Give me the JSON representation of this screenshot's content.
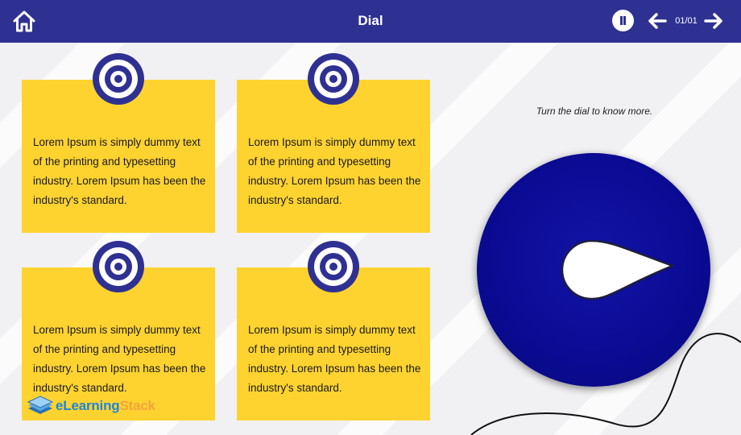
{
  "header": {
    "title": "Dial",
    "page_indicator": "01/01",
    "icons": {
      "home": "home-icon",
      "pause": "pause-icon",
      "prev": "arrow-left-icon",
      "next": "arrow-right-icon"
    }
  },
  "cards": [
    {
      "icon": "target-icon",
      "text": "Lorem Ipsum is simply dummy text of the printing and typesetting industry. Lorem Ipsum has been the industry's standard."
    },
    {
      "icon": "target-icon",
      "text": "Lorem Ipsum is simply dummy text of the printing and typesetting industry. Lorem Ipsum has been the industry's standard."
    },
    {
      "icon": "target-icon",
      "text": "Lorem Ipsum is simply dummy text of the printing and typesetting industry. Lorem Ipsum has been the industry's standard."
    },
    {
      "icon": "target-icon",
      "text": "Lorem Ipsum is simply dummy text of the printing and typesetting industry. Lorem Ipsum has been the industry's standard."
    }
  ],
  "dial": {
    "instruction": "Turn the dial to know more."
  },
  "logo": {
    "part1": "eLearning",
    "part2": "Stack"
  },
  "colors": {
    "header_bg": "#2e3192",
    "card_bg": "#fed330",
    "dial_bg": "#0b0b95",
    "logo_blue": "#1f86d6",
    "logo_orange": "#f4a43a"
  }
}
